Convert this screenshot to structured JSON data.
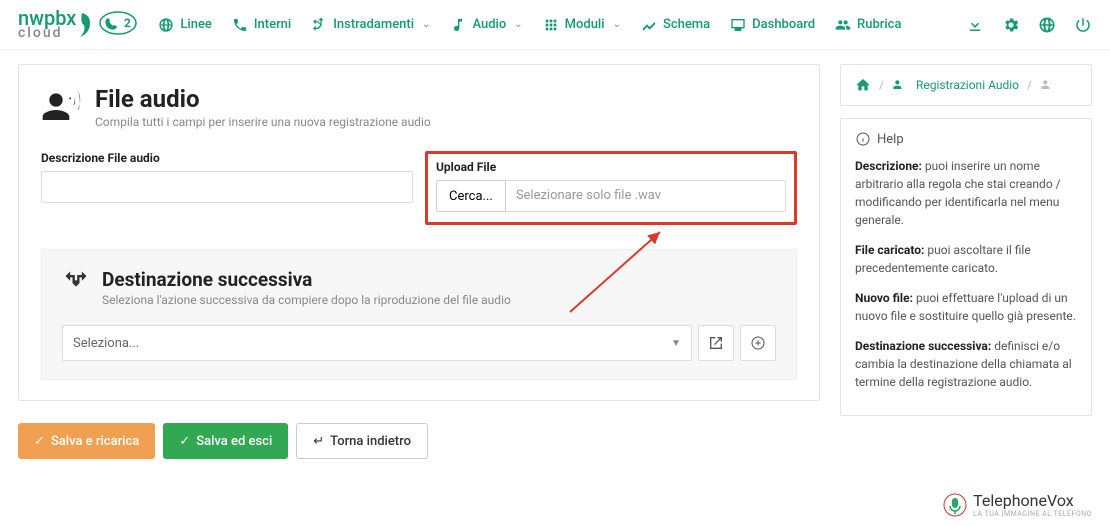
{
  "logo": {
    "main": "nwpbx",
    "sub": "cloud",
    "badge": "2"
  },
  "nav": {
    "linee": "Linee",
    "interni": "Interni",
    "instradamenti": "Instradamenti",
    "audio": "Audio",
    "moduli": "Moduli",
    "schema": "Schema",
    "dashboard": "Dashboard",
    "rubrica": "Rubrica"
  },
  "breadcrumb": {
    "item1": "Registrazioni Audio"
  },
  "page": {
    "title": "File audio",
    "subtitle": "Compila tutti i campi per inserire una nuova registrazione audio"
  },
  "form": {
    "desc_label": "Descrizione File audio",
    "upload_label": "Upload File",
    "browse_btn": "Cerca...",
    "upload_placeholder": "Selezionare solo file .wav"
  },
  "dest": {
    "title": "Destinazione successiva",
    "subtitle": "Seleziona l'azione successiva da compiere dopo la riproduzione del file audio",
    "select_placeholder": "Seleziona..."
  },
  "actions": {
    "save_reload": "Salva e ricarica",
    "save_exit": "Salva ed esci",
    "back": "Torna indietro"
  },
  "help": {
    "title": "Help",
    "p1_label": "Descrizione:",
    "p1_body": " puoi inserire un nome arbitrario alla regola che stai creando / modificando per identificarla nel menu generale.",
    "p2_label": "File caricato:",
    "p2_body": " puoi ascoltare il file precedentemente caricato.",
    "p3_label": "Nuovo file:",
    "p3_body": " puoi effettuare l'upload di un nuovo file e sostituire quello già presente.",
    "p4_label": "Destinazione successiva:",
    "p4_body": " definisci e/o cambia la destinazione della chiamata al termine della registrazione audio."
  },
  "footer": {
    "brand": "TelephoneVox",
    "tagline": "LA TUA IMMAGINE AL TELEFONO"
  }
}
